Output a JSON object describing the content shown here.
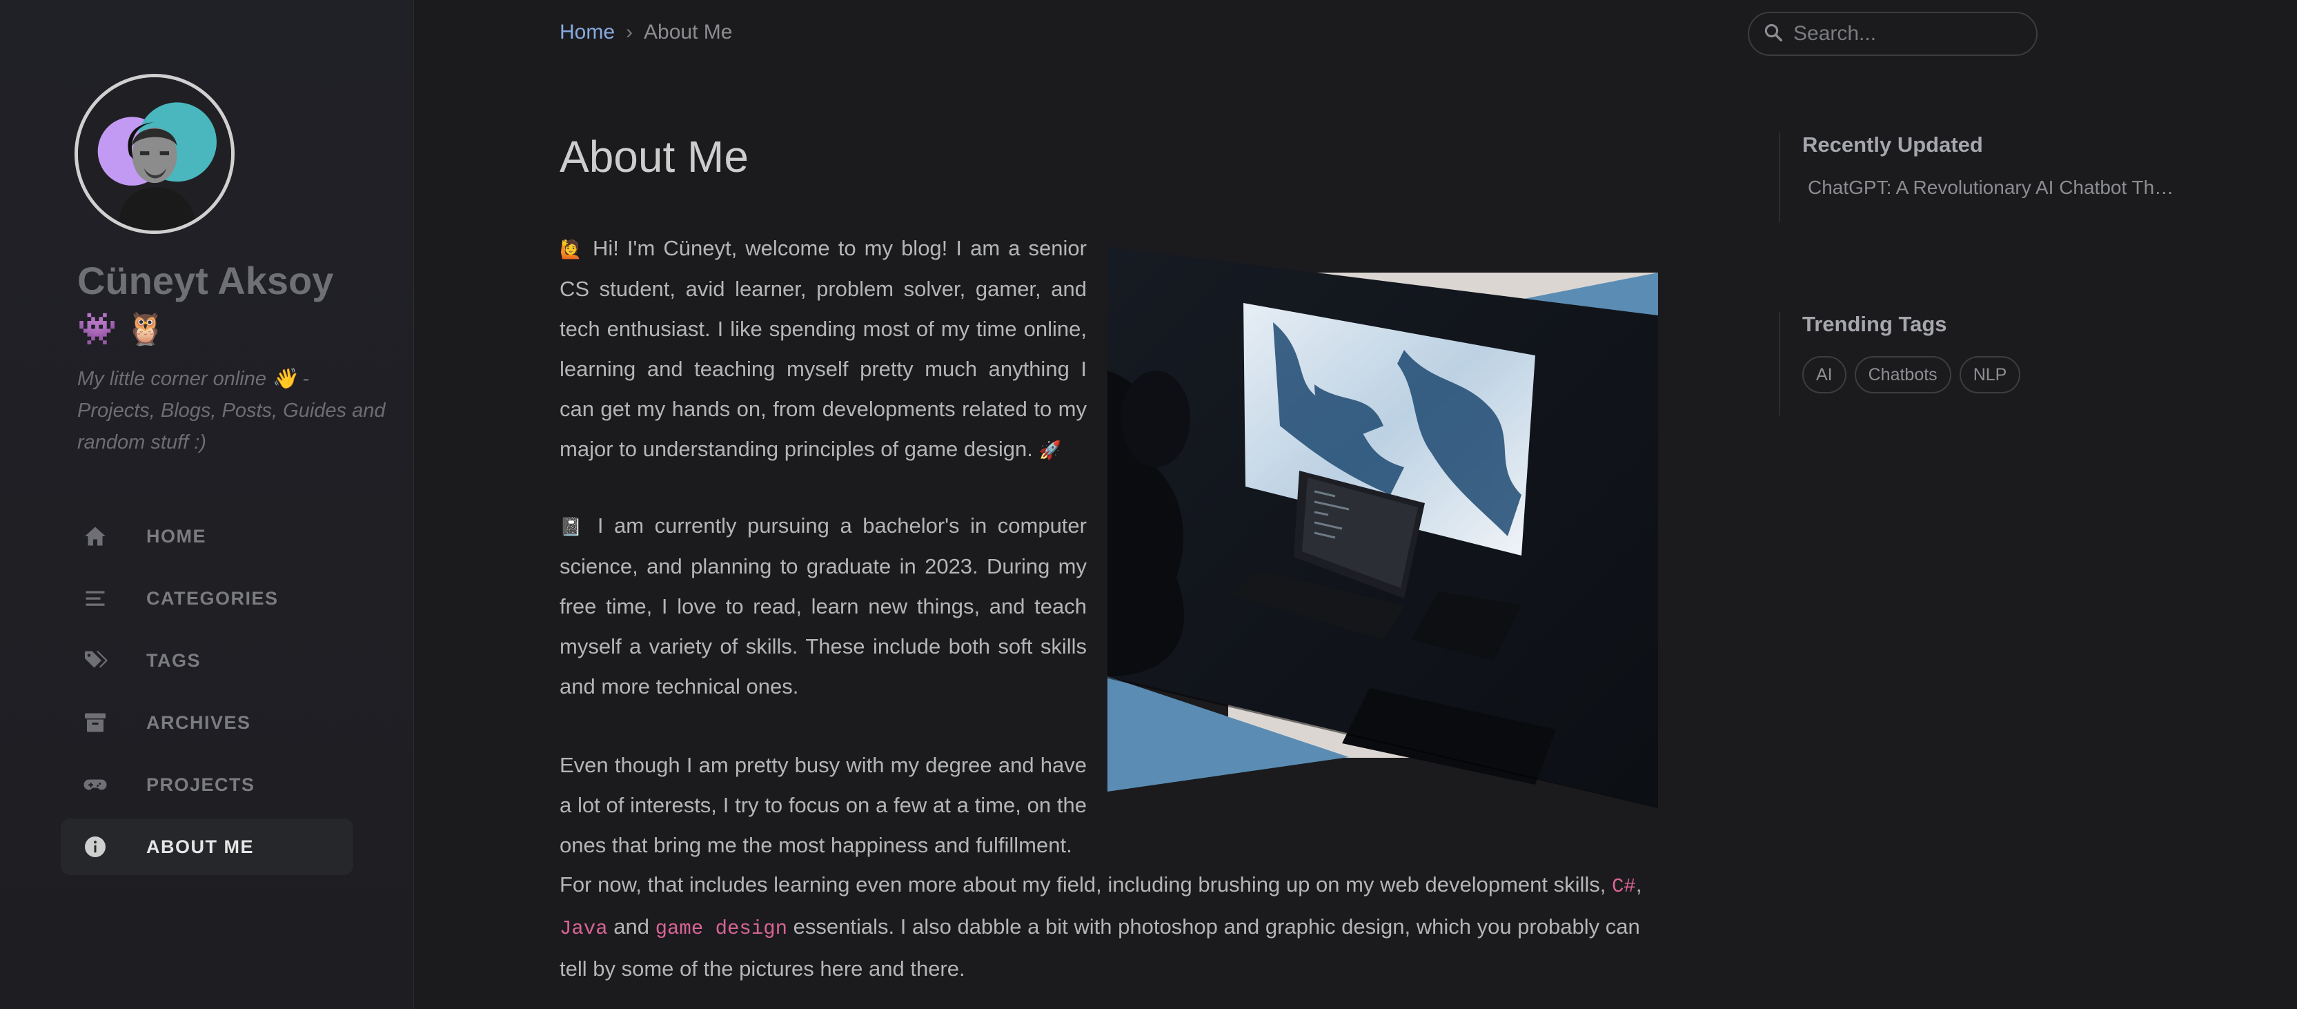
{
  "sidebar": {
    "title": "Cüneyt Aksoy",
    "title_emoji": "👾 🦉",
    "subtitle": "My little corner online 👋 - Projects, Blogs, Posts, Guides and random stuff :)",
    "nav": [
      {
        "label": "HOME",
        "icon": "home-icon"
      },
      {
        "label": "CATEGORIES",
        "icon": "list-icon"
      },
      {
        "label": "TAGS",
        "icon": "tags-icon"
      },
      {
        "label": "ARCHIVES",
        "icon": "archive-icon"
      },
      {
        "label": "PROJECTS",
        "icon": "gamepad-icon"
      },
      {
        "label": "ABOUT ME",
        "icon": "info-icon",
        "active": true
      }
    ]
  },
  "breadcrumb": {
    "home": "Home",
    "separator": "›",
    "current": "About Me"
  },
  "search": {
    "placeholder": "Search..."
  },
  "main": {
    "title": "About Me",
    "p1_emoji": "🙋",
    "p1": "Hi! I'm Cüneyt, welcome to my blog! I am a senior CS student, avid learner, problem solver, gamer, and tech enthusiast. I like spending most of my time online, learning and teaching myself pretty much anything I can get my hands on, from developments related to my major to understanding principles of game design.",
    "p1_end_emoji": "🚀",
    "p2_emoji": "📓",
    "p2": "I am currently pursuing a bachelor's in computer science, and planning to graduate in 2023. During my free time, I love to read, learn new things, and teach myself a variety of skills. These include both soft skills and more technical ones.",
    "p3": "Even though I am pretty busy with my degree and have a lot of interests, I try to focus on a few at a time, on the ones that bring me the most happiness and fulfillment.",
    "p4_a": "For now, that includes learning even more about my field, including brushing up on my web development skills,",
    "p4_code1": "C#",
    "p4_sep": ",",
    "p4_code2": "Java",
    "p4_and": "and",
    "p4_code3": "game design",
    "p4_b": "essentials. I also dabble a bit with photoshop and graphic design, which you probably can tell by some of the pictures here and there."
  },
  "panel": {
    "recent_title": "Recently Updated",
    "recent_items": [
      "ChatGPT: A Revolutionary AI Chatbot Th…"
    ],
    "trending_title": "Trending Tags",
    "tags": [
      "AI",
      "Chatbots",
      "NLP"
    ]
  },
  "colors": {
    "background": "#1b1b1e",
    "link": "#89a9dd",
    "code": "#d86494",
    "accent_blue": "#5b8db4"
  }
}
